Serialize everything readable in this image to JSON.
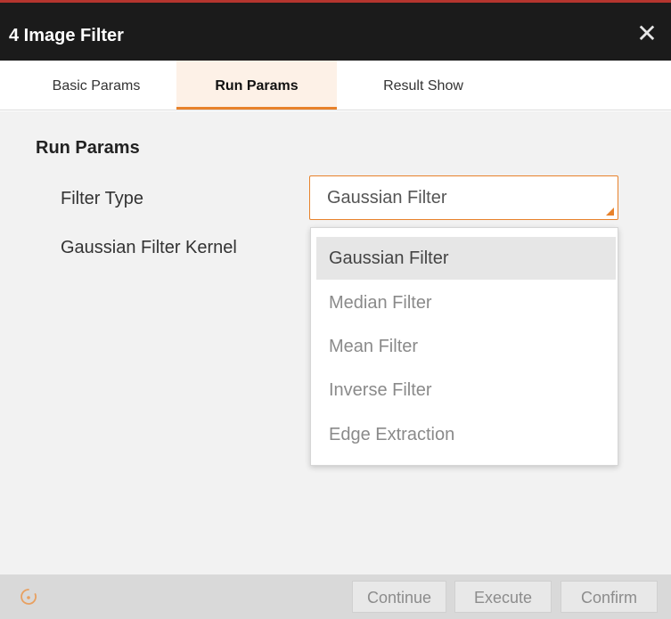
{
  "window": {
    "title": "4 Image Filter",
    "close_icon": "close-icon"
  },
  "tabs": [
    {
      "label": "Basic Params",
      "active": false
    },
    {
      "label": "Run Params",
      "active": true
    },
    {
      "label": "Result Show",
      "active": false
    }
  ],
  "run_params": {
    "section_title": "Run Params",
    "filter_type": {
      "label": "Filter Type",
      "value": "Gaussian Filter",
      "options": [
        "Gaussian Filter",
        "Median Filter",
        "Mean Filter",
        "Inverse Filter",
        "Edge Extraction"
      ],
      "highlighted": "Gaussian Filter"
    },
    "kernel": {
      "label": "Gaussian Filter Kernel"
    }
  },
  "footer": {
    "loading_icon": "loading-icon",
    "buttons": {
      "continue": "Continue",
      "execute": "Execute",
      "confirm": "Confirm"
    }
  },
  "colors": {
    "accent": "#e8822b",
    "title_bar": "#1b1b1b",
    "title_border": "#b5352e"
  }
}
